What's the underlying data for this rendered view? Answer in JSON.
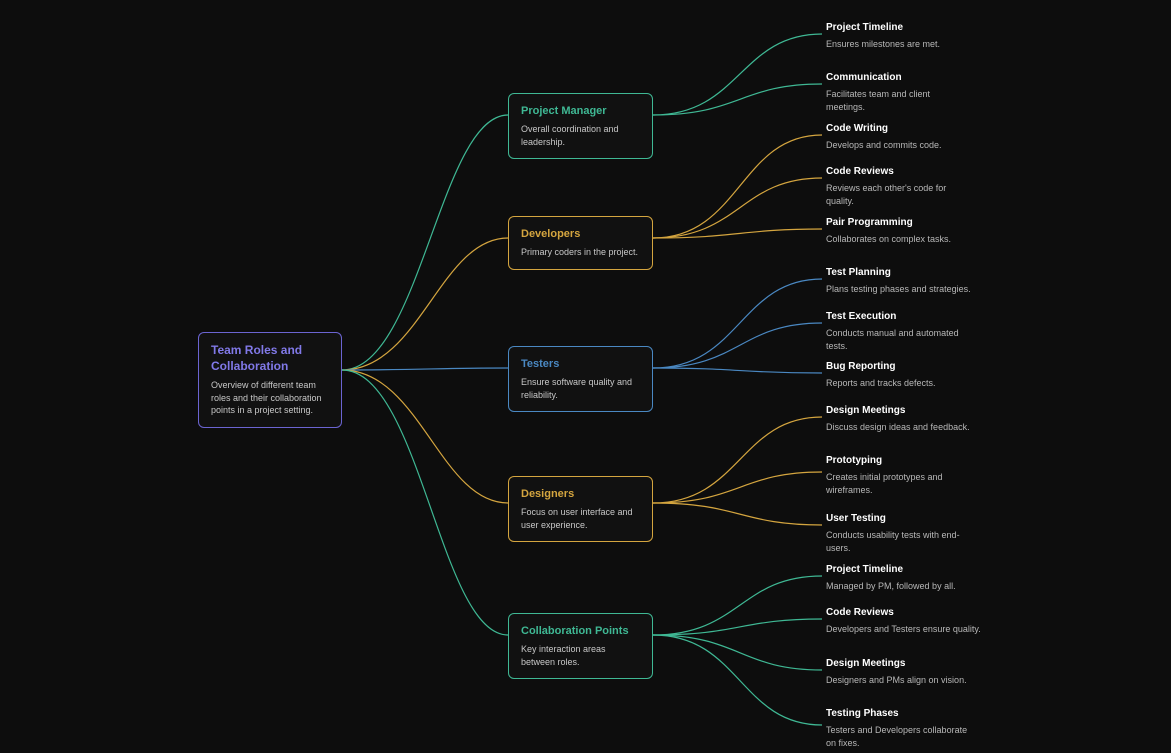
{
  "root": {
    "title": "Team Roles and Collaboration",
    "desc": "Overview of different team roles and their collaboration points in a project setting."
  },
  "branches": [
    {
      "key": "pm",
      "title": "Project Manager",
      "desc": "Overall coordination and leadership.",
      "color": "#3fb894",
      "children": [
        {
          "title": "Project Timeline",
          "desc": "Ensures milestones are met."
        },
        {
          "title": "Communication",
          "desc": "Facilitates team and client meetings."
        }
      ]
    },
    {
      "key": "dev",
      "title": "Developers",
      "desc": "Primary coders in the project.",
      "color": "#d4a53f",
      "children": [
        {
          "title": "Code Writing",
          "desc": "Develops and commits code."
        },
        {
          "title": "Code Reviews",
          "desc": "Reviews each other's code for quality."
        },
        {
          "title": "Pair Programming",
          "desc": "Collaborates on complex tasks."
        }
      ]
    },
    {
      "key": "test",
      "title": "Testers",
      "desc": "Ensure software quality and reliability.",
      "color": "#4a88c2",
      "children": [
        {
          "title": "Test Planning",
          "desc": "Plans testing phases and strategies."
        },
        {
          "title": "Test Execution",
          "desc": "Conducts manual and automated tests."
        },
        {
          "title": "Bug Reporting",
          "desc": "Reports and tracks defects."
        }
      ]
    },
    {
      "key": "des",
      "title": "Designers",
      "desc": "Focus on user interface and user experience.",
      "color": "#d4a53f",
      "children": [
        {
          "title": "Design Meetings",
          "desc": "Discuss design ideas and feedback."
        },
        {
          "title": "Prototyping",
          "desc": "Creates initial prototypes and wireframes."
        },
        {
          "title": "User Testing",
          "desc": "Conducts usability tests with end-users."
        }
      ]
    },
    {
      "key": "collab",
      "title": "Collaboration Points",
      "desc": "Key interaction areas between roles.",
      "color": "#3fb894",
      "children": [
        {
          "title": "Project Timeline",
          "desc": "Managed by PM, followed by all."
        },
        {
          "title": "Code Reviews",
          "desc": "Developers and Testers ensure quality."
        },
        {
          "title": "Design Meetings",
          "desc": "Designers and PMs align on vision."
        },
        {
          "title": "Testing Phases",
          "desc": "Testers and Developers collaborate on fixes."
        }
      ]
    }
  ],
  "chart_data": {
    "type": "mindmap",
    "root": "Team Roles and Collaboration",
    "branches": {
      "Project Manager": [
        "Project Timeline",
        "Communication"
      ],
      "Developers": [
        "Code Writing",
        "Code Reviews",
        "Pair Programming"
      ],
      "Testers": [
        "Test Planning",
        "Test Execution",
        "Bug Reporting"
      ],
      "Designers": [
        "Design Meetings",
        "Prototyping",
        "User Testing"
      ],
      "Collaboration Points": [
        "Project Timeline",
        "Code Reviews",
        "Design Meetings",
        "Testing Phases"
      ]
    }
  }
}
